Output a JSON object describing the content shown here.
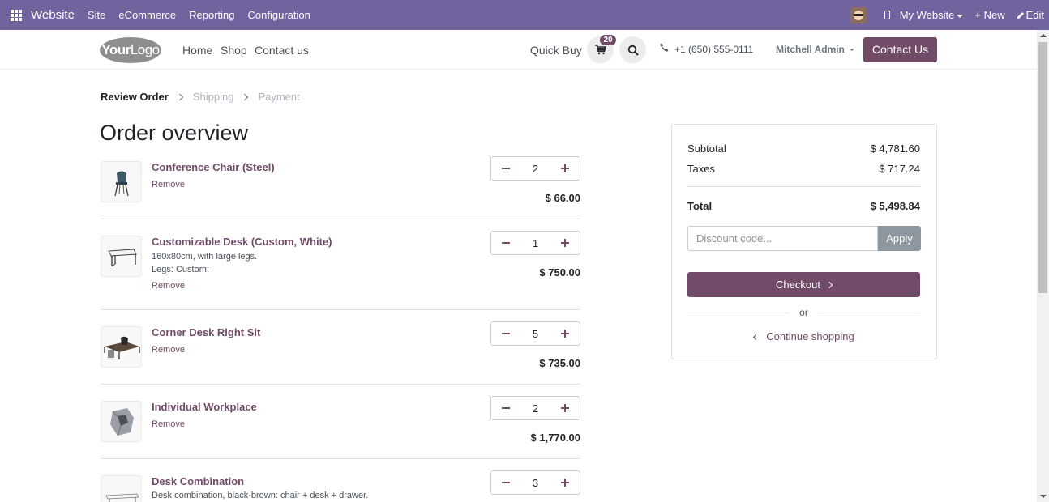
{
  "admin_bar": {
    "brand": "Website",
    "menus": [
      "Site",
      "eCommerce",
      "Reporting",
      "Configuration"
    ],
    "website_switch": "My Website",
    "new_label": "+ New",
    "edit_label": "Edit"
  },
  "header": {
    "logo_bold": "Your",
    "logo_light": "Logo",
    "nav": [
      "Home",
      "Shop",
      "Contact us"
    ],
    "quick_buy": "Quick Buy",
    "cart_count": "20",
    "phone": "+1 (650) 555-0111",
    "user": "Mitchell Admin",
    "contact_button": "Contact Us"
  },
  "breadcrumb": {
    "steps": [
      "Review Order",
      "Shipping",
      "Payment"
    ]
  },
  "page_title": "Order overview",
  "lines": [
    {
      "name": "Conference Chair (Steel)",
      "desc": [],
      "remove": "Remove",
      "qty": "2",
      "price": "$ 66.00"
    },
    {
      "name": "Customizable Desk (Custom, White)",
      "desc": [
        "160x80cm, with large legs.",
        "Legs: Custom:"
      ],
      "remove": "Remove",
      "qty": "1",
      "price": "$ 750.00"
    },
    {
      "name": "Corner Desk Right Sit",
      "desc": [],
      "remove": "Remove",
      "qty": "5",
      "price": "$ 735.00"
    },
    {
      "name": "Individual Workplace",
      "desc": [],
      "remove": "Remove",
      "qty": "2",
      "price": "$ 1,770.00"
    },
    {
      "name": "Desk Combination",
      "desc": [
        "Desk combination, black-brown: chair + desk + drawer."
      ],
      "remove": "",
      "qty": "3",
      "price": ""
    }
  ],
  "summary": {
    "subtotal_label": "Subtotal",
    "subtotal": "$ 4,781.60",
    "taxes_label": "Taxes",
    "taxes": "$ 717.24",
    "total_label": "Total",
    "total": "$ 5,498.84",
    "discount_placeholder": "Discount code...",
    "apply": "Apply",
    "checkout": "Checkout",
    "or": "or",
    "continue": "Continue shopping"
  },
  "colors": {
    "admin_bar": "#71639e",
    "brand": "#714b67"
  }
}
